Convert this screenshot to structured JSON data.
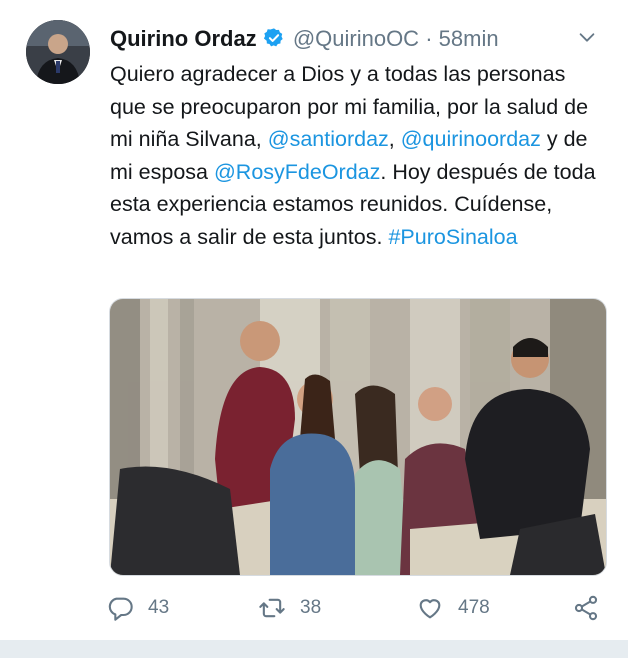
{
  "tweet": {
    "author_name": "Quirino Ordaz",
    "author_handle": "@QuirinoOC",
    "separator": "·",
    "time": "58min",
    "text": {
      "p1": "Quiero agradecer a Dios y a todas las personas que se preocuparon por mi familia, por la salud de mi niña Silvana, ",
      "m1": "@santiordaz",
      "p2": ", ",
      "m2": "@quirinoordaz",
      "p3": " y de mi esposa ",
      "m3": "@RosyFdeOrdaz",
      "p4": ". Hoy después de toda esta experiencia estamos reunidos. Cuídense, vamos a salir de esta juntos. ",
      "hashtag": "#PuroSinaloa"
    },
    "actions": {
      "replies": "43",
      "retweets": "38",
      "likes": "478"
    },
    "colors": {
      "link": "#1b95e0",
      "secondary": "#657786",
      "verified": "#1da1f2"
    },
    "icons": [
      "verified-badge-icon",
      "chevron-down-icon",
      "reply-icon",
      "retweet-icon",
      "like-icon",
      "share-icon"
    ]
  }
}
